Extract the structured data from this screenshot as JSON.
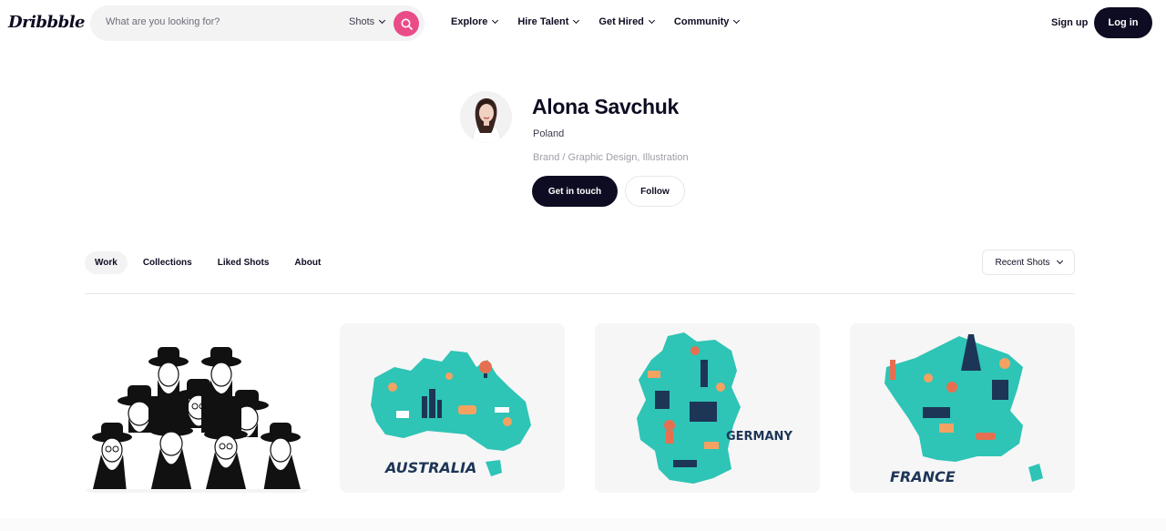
{
  "nav": {
    "logo": "Dribbble",
    "search_placeholder": "What are you looking for?",
    "search_scope": "Shots",
    "menu": [
      {
        "label": "Explore"
      },
      {
        "label": "Hire Talent"
      },
      {
        "label": "Get Hired"
      },
      {
        "label": "Community"
      }
    ],
    "signup": "Sign up",
    "login": "Log in"
  },
  "profile": {
    "name": "Alona Savchuk",
    "location": "Poland",
    "skills": "Brand / Graphic Design, Illustration",
    "cta_primary": "Get in touch",
    "cta_secondary": "Follow"
  },
  "tabs": [
    {
      "label": "Work",
      "active": true
    },
    {
      "label": "Collections",
      "active": false
    },
    {
      "label": "Liked Shots",
      "active": false
    },
    {
      "label": "About",
      "active": false
    }
  ],
  "sort": {
    "label": "Recent Shots"
  },
  "shots": [
    {
      "title_text": ""
    },
    {
      "title_text": "AUSTRALIA"
    },
    {
      "title_text": "GERMANY"
    },
    {
      "title_text": "FRANCE"
    }
  ],
  "colors": {
    "brand_pink": "#ea4c89",
    "dark": "#0d0c22",
    "map_teal": "#2ec4b6",
    "map_navy": "#1d3557"
  }
}
